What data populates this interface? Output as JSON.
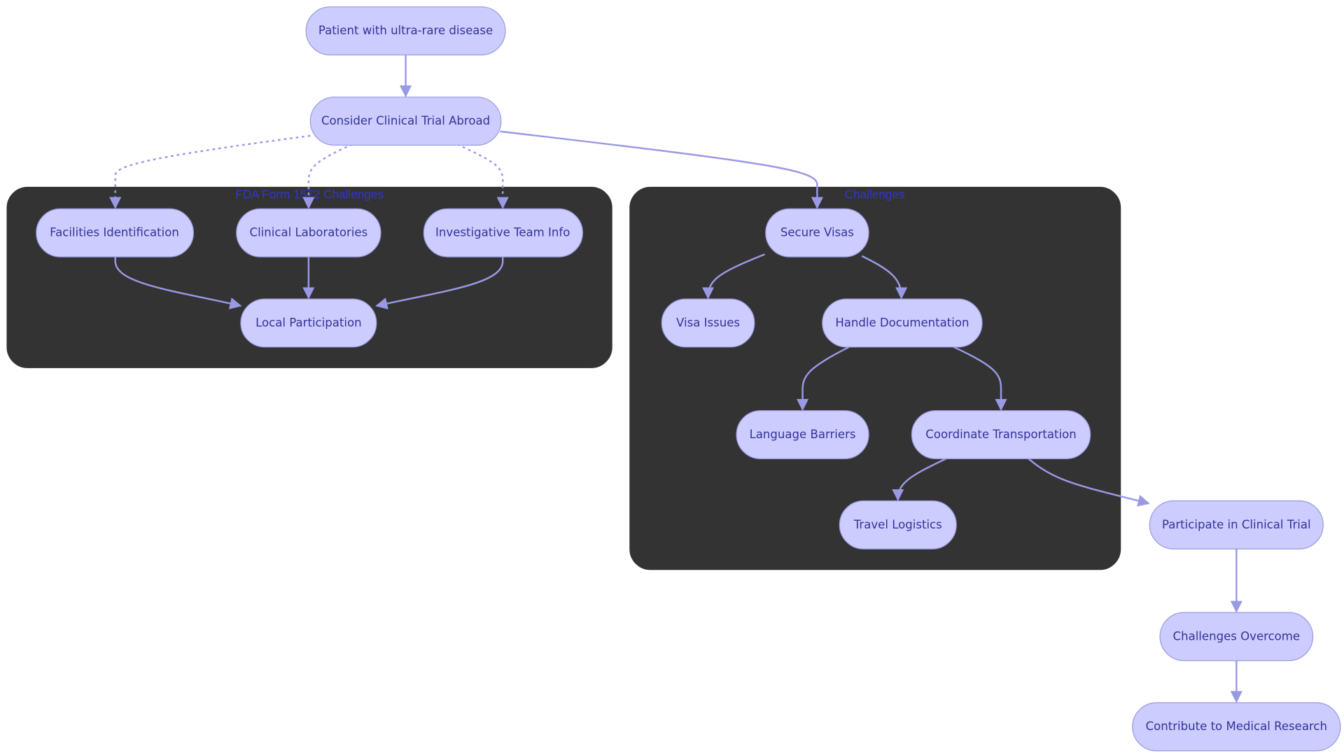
{
  "diagram": {
    "type": "flowchart",
    "colors": {
      "node_fill": "#ccccff",
      "node_stroke": "#9a9ae0",
      "node_text": "#333399",
      "edge": "#9999e6",
      "cluster_fill": "#333333",
      "cluster_label": "#3236c8",
      "background": "#ffffff"
    },
    "clusters": [
      {
        "id": "fda",
        "label": "FDA Form 1572 Challenges"
      },
      {
        "id": "challenges",
        "label": "Challenges"
      }
    ],
    "nodes": [
      {
        "id": "patient",
        "label": "Patient with ultra-rare disease"
      },
      {
        "id": "consider",
        "label": "Consider Clinical Trial Abroad"
      },
      {
        "id": "facilities",
        "label": "Facilities Identification",
        "cluster": "fda"
      },
      {
        "id": "labs",
        "label": "Clinical Laboratories",
        "cluster": "fda"
      },
      {
        "id": "team",
        "label": "Investigative Team Info",
        "cluster": "fda"
      },
      {
        "id": "local",
        "label": "Local Participation",
        "cluster": "fda"
      },
      {
        "id": "visas",
        "label": "Secure Visas",
        "cluster": "challenges"
      },
      {
        "id": "visaissues",
        "label": "Visa Issues",
        "cluster": "challenges"
      },
      {
        "id": "docs",
        "label": "Handle Documentation",
        "cluster": "challenges"
      },
      {
        "id": "language",
        "label": "Language Barriers",
        "cluster": "challenges"
      },
      {
        "id": "transport",
        "label": "Coordinate Transportation",
        "cluster": "challenges"
      },
      {
        "id": "travel",
        "label": "Travel Logistics",
        "cluster": "challenges"
      },
      {
        "id": "participate",
        "label": "Participate in Clinical Trial"
      },
      {
        "id": "overcome",
        "label": "Challenges Overcome"
      },
      {
        "id": "contribute",
        "label": "Contribute to Medical Research"
      }
    ],
    "edges": [
      {
        "from": "patient",
        "to": "consider",
        "style": "solid"
      },
      {
        "from": "consider",
        "to": "facilities",
        "style": "dotted"
      },
      {
        "from": "consider",
        "to": "labs",
        "style": "dotted"
      },
      {
        "from": "consider",
        "to": "team",
        "style": "dotted"
      },
      {
        "from": "consider",
        "to": "visas",
        "style": "solid"
      },
      {
        "from": "facilities",
        "to": "local",
        "style": "solid"
      },
      {
        "from": "labs",
        "to": "local",
        "style": "solid"
      },
      {
        "from": "team",
        "to": "local",
        "style": "solid"
      },
      {
        "from": "visas",
        "to": "visaissues",
        "style": "solid"
      },
      {
        "from": "visas",
        "to": "docs",
        "style": "solid"
      },
      {
        "from": "docs",
        "to": "language",
        "style": "solid"
      },
      {
        "from": "docs",
        "to": "transport",
        "style": "solid"
      },
      {
        "from": "transport",
        "to": "travel",
        "style": "solid"
      },
      {
        "from": "transport",
        "to": "participate",
        "style": "solid"
      },
      {
        "from": "participate",
        "to": "overcome",
        "style": "solid"
      },
      {
        "from": "overcome",
        "to": "contribute",
        "style": "solid"
      }
    ]
  }
}
